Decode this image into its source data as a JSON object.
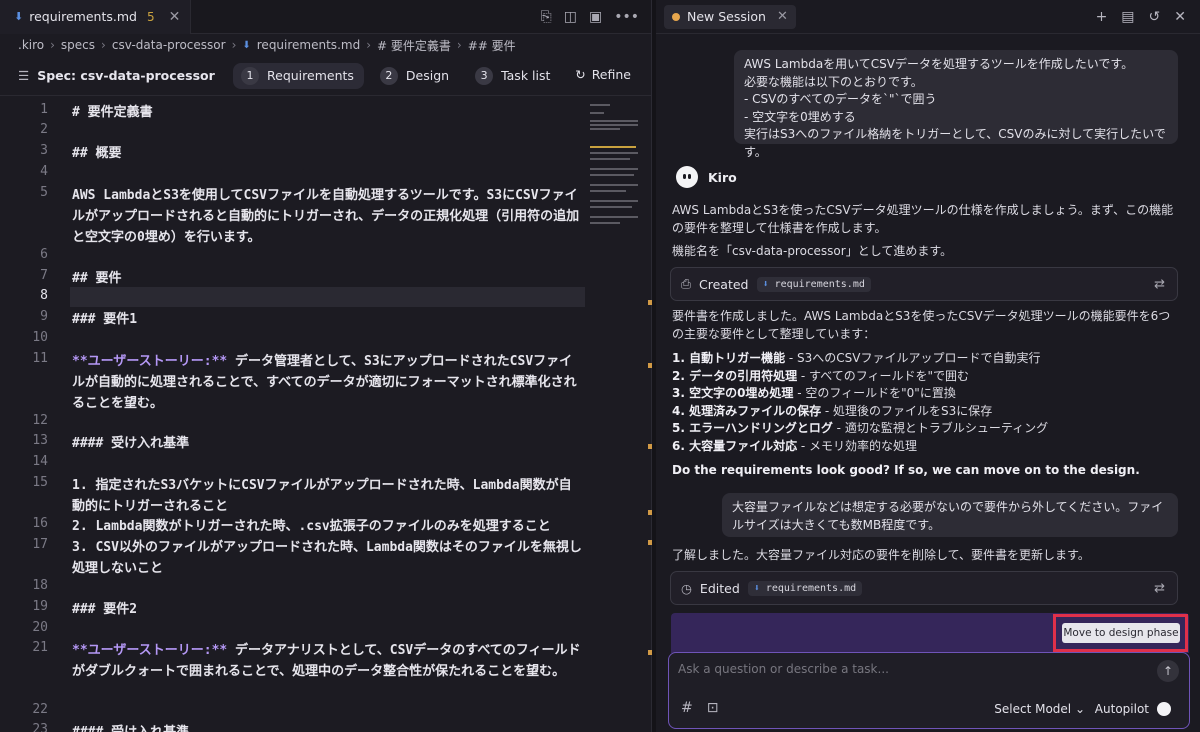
{
  "editor": {
    "tab": {
      "filename": "requirements.md",
      "badge": "5",
      "close": "✕"
    },
    "actions": [
      "⎘",
      "◫",
      "▣",
      "•••"
    ],
    "breadcrumb": [
      ".kiro",
      "specs",
      "csv-data-processor",
      "requirements.md",
      "# 要件定義書",
      "## 要件"
    ],
    "spec": {
      "title": "Spec: csv-data-processor",
      "tabs": [
        {
          "num": "1",
          "label": "Requirements"
        },
        {
          "num": "2",
          "label": "Design"
        },
        {
          "num": "3",
          "label": "Task list"
        }
      ],
      "refine": "Refine"
    },
    "lines": [
      {
        "n": "1",
        "text": "# 要件定義書"
      },
      {
        "n": "2",
        "text": ""
      },
      {
        "n": "3",
        "text": "## 概要"
      },
      {
        "n": "4",
        "text": ""
      },
      {
        "n": "5",
        "text": "AWS LambdaとS3を使用してCSVファイルを自動処理するツールです。S3にCSVファイルがアップロードされると自動的にトリガーされ、データの正規化処理（引用符の追加と空文字の0埋め）を行います。"
      },
      {
        "n": "6",
        "text": ""
      },
      {
        "n": "7",
        "text": "## 要件"
      },
      {
        "n": "8",
        "text": ""
      },
      {
        "n": "9",
        "text": "### 要件1"
      },
      {
        "n": "10",
        "text": ""
      },
      {
        "n": "11",
        "kw": "**ユーザーストーリー:**",
        "text": " データ管理者として、S3にアップロードされたCSVファイルが自動的に処理されることで、すべてのデータが適切にフォーマットされ標準化されることを望む。"
      },
      {
        "n": "12",
        "text": ""
      },
      {
        "n": "13",
        "text": "#### 受け入れ基準"
      },
      {
        "n": "14",
        "text": ""
      },
      {
        "n": "15",
        "text": "1. 指定されたS3バケットにCSVファイルがアップロードされた時、Lambda関数が自動的にトリガーされること"
      },
      {
        "n": "16",
        "text": "2. Lambda関数がトリガーされた時、.csv拡張子のファイルのみを処理すること"
      },
      {
        "n": "17",
        "text": "3. CSV以外のファイルがアップロードされた時、Lambda関数はそのファイルを無視し処理しないこと"
      },
      {
        "n": "18",
        "text": ""
      },
      {
        "n": "19",
        "text": "### 要件2"
      },
      {
        "n": "20",
        "text": ""
      },
      {
        "n": "21",
        "kw": "**ユーザーストーリー:**",
        "text": " データアナリストとして、CSVデータのすべてのフィールドがダブルクォートで囲まれることで、処理中のデータ整合性が保たれることを望む。"
      },
      {
        "n": "22",
        "text": ""
      },
      {
        "n": "23",
        "text": "#### 受け入れ基準"
      }
    ]
  },
  "chat": {
    "session_tab": "New Session",
    "user_msg_1": [
      "AWS Lambdaを用いてCSVデータを処理するツールを作成したいです。",
      "必要な機能は以下のとおりです。",
      "- CSVのすべてのデータを`\"`で囲う",
      "- 空文字を0埋めする",
      "実行はS3へのファイル格納をトリガーとして、CSVのみに対して実行したいです。"
    ],
    "agent_name": "Kiro",
    "agent_msg_1": "AWS LambdaとS3を使ったCSVデータ処理ツールの仕様を作成しましょう。まず、この機能の要件を整理して仕様書を作成します。",
    "agent_msg_2": "機能名を「csv-data-processor」として進めます。",
    "created_label": "Created",
    "file_chip": "requirements.md",
    "agent_msg_3": "要件書を作成しました。AWS LambdaとS3を使ったCSVデータ処理ツールの機能要件を6つの主要な要件として整理しています：",
    "req_list": [
      {
        "b": "1. 自動トリガー機能",
        "t": " - S3へのCSVファイルアップロードで自動実行"
      },
      {
        "b": "2. データの引用符処理",
        "t": " - すべてのフィールドを\"で囲む"
      },
      {
        "b": "3. 空文字の0埋め処理",
        "t": " - 空のフィールドを\"0\"に置換"
      },
      {
        "b": "4. 処理済みファイルの保存",
        "t": " - 処理後のファイルをS3に保存"
      },
      {
        "b": "5. エラーハンドリングとログ",
        "t": " - 適切な監視とトラブルシューティング"
      },
      {
        "b": "6. 大容量ファイル対応",
        "t": " - メモリ効率的な処理"
      }
    ],
    "question": "Do the requirements look good? If so, we can move on to the design.",
    "user_msg_2": "大容量ファイルなどは想定する必要がないので要件から外してください。ファイルサイズは大きくても数MB程度です。",
    "agent_msg_4": "了解しました。大容量ファイル対応の要件を削除して、要件書を更新します。",
    "edited_label": "Edited",
    "move_button": "Move to design phase",
    "input_placeholder": "Ask a question or describe a task...",
    "model_select": "Select Model ⌄",
    "autopilot": "Autopilot"
  }
}
